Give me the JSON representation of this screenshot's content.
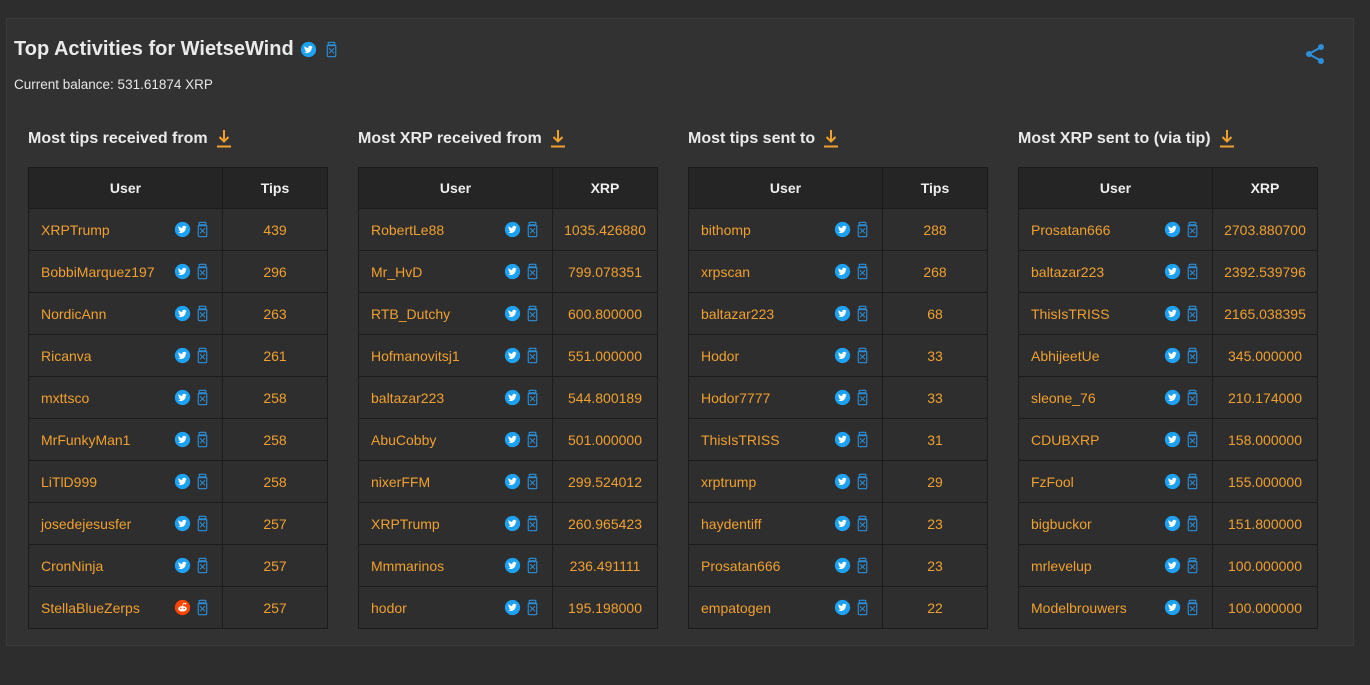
{
  "header": {
    "title": "Top Activities for WietseWind",
    "balance": "Current balance: 531.61874 XRP"
  },
  "colors": {
    "accent": "#f0a030",
    "twitter": "#1da1f2",
    "reddit": "#ff4500",
    "share": "#2b90d9"
  },
  "sections": [
    {
      "title": "Most tips received from",
      "col_user": "User",
      "col_value": "Tips",
      "rows": [
        {
          "user": "XRPTrump",
          "value": "439",
          "network": "twitter"
        },
        {
          "user": "BobbiMarquez197",
          "value": "296",
          "network": "twitter"
        },
        {
          "user": "NordicAnn",
          "value": "263",
          "network": "twitter"
        },
        {
          "user": "Ricanva",
          "value": "261",
          "network": "twitter"
        },
        {
          "user": "mxttsco",
          "value": "258",
          "network": "twitter"
        },
        {
          "user": "MrFunkyMan1",
          "value": "258",
          "network": "twitter"
        },
        {
          "user": "LiTlD999",
          "value": "258",
          "network": "twitter"
        },
        {
          "user": "josedejesusfer",
          "value": "257",
          "network": "twitter"
        },
        {
          "user": "CronNinja",
          "value": "257",
          "network": "twitter"
        },
        {
          "user": "StellaBlueZerps",
          "value": "257",
          "network": "reddit"
        }
      ]
    },
    {
      "title": "Most XRP received from",
      "col_user": "User",
      "col_value": "XRP",
      "rows": [
        {
          "user": "RobertLe88",
          "value": "1035.426880",
          "network": "twitter"
        },
        {
          "user": "Mr_HvD",
          "value": "799.078351",
          "network": "twitter"
        },
        {
          "user": "RTB_Dutchy",
          "value": "600.800000",
          "network": "twitter"
        },
        {
          "user": "Hofmanovitsj1",
          "value": "551.000000",
          "network": "twitter"
        },
        {
          "user": "baltazar223",
          "value": "544.800189",
          "network": "twitter"
        },
        {
          "user": "AbuCobby",
          "value": "501.000000",
          "network": "twitter"
        },
        {
          "user": "nixerFFM",
          "value": "299.524012",
          "network": "twitter"
        },
        {
          "user": "XRPTrump",
          "value": "260.965423",
          "network": "twitter"
        },
        {
          "user": "Mmmarinos",
          "value": "236.491111",
          "network": "twitter"
        },
        {
          "user": "hodor",
          "value": "195.198000",
          "network": "twitter"
        }
      ]
    },
    {
      "title": "Most tips sent to",
      "col_user": "User",
      "col_value": "Tips",
      "rows": [
        {
          "user": "bithomp",
          "value": "288",
          "network": "twitter"
        },
        {
          "user": "xrpscan",
          "value": "268",
          "network": "twitter"
        },
        {
          "user": "baltazar223",
          "value": "68",
          "network": "twitter"
        },
        {
          "user": "Hodor",
          "value": "33",
          "network": "twitter"
        },
        {
          "user": "Hodor7777",
          "value": "33",
          "network": "twitter"
        },
        {
          "user": "ThisIsTRISS",
          "value": "31",
          "network": "twitter"
        },
        {
          "user": "xrptrump",
          "value": "29",
          "network": "twitter"
        },
        {
          "user": "haydentiff",
          "value": "23",
          "network": "twitter"
        },
        {
          "user": "Prosatan666",
          "value": "23",
          "network": "twitter"
        },
        {
          "user": "empatogen",
          "value": "22",
          "network": "twitter"
        }
      ]
    },
    {
      "title": "Most XRP sent to (via tip)",
      "col_user": "User",
      "col_value": "XRP",
      "rows": [
        {
          "user": "Prosatan666",
          "value": "2703.880700",
          "network": "twitter"
        },
        {
          "user": "baltazar223",
          "value": "2392.539796",
          "network": "twitter"
        },
        {
          "user": "ThisIsTRISS",
          "value": "2165.038395",
          "network": "twitter"
        },
        {
          "user": "AbhijeetUe",
          "value": "345.000000",
          "network": "twitter"
        },
        {
          "user": "sleone_76",
          "value": "210.174000",
          "network": "twitter"
        },
        {
          "user": "CDUBXRP",
          "value": "158.000000",
          "network": "twitter"
        },
        {
          "user": "FzFool",
          "value": "155.000000",
          "network": "twitter"
        },
        {
          "user": "bigbuckor",
          "value": "151.800000",
          "network": "twitter"
        },
        {
          "user": "mrlevelup",
          "value": "100.000000",
          "network": "twitter"
        },
        {
          "user": "Modelbrouwers",
          "value": "100.000000",
          "network": "twitter"
        }
      ]
    }
  ]
}
